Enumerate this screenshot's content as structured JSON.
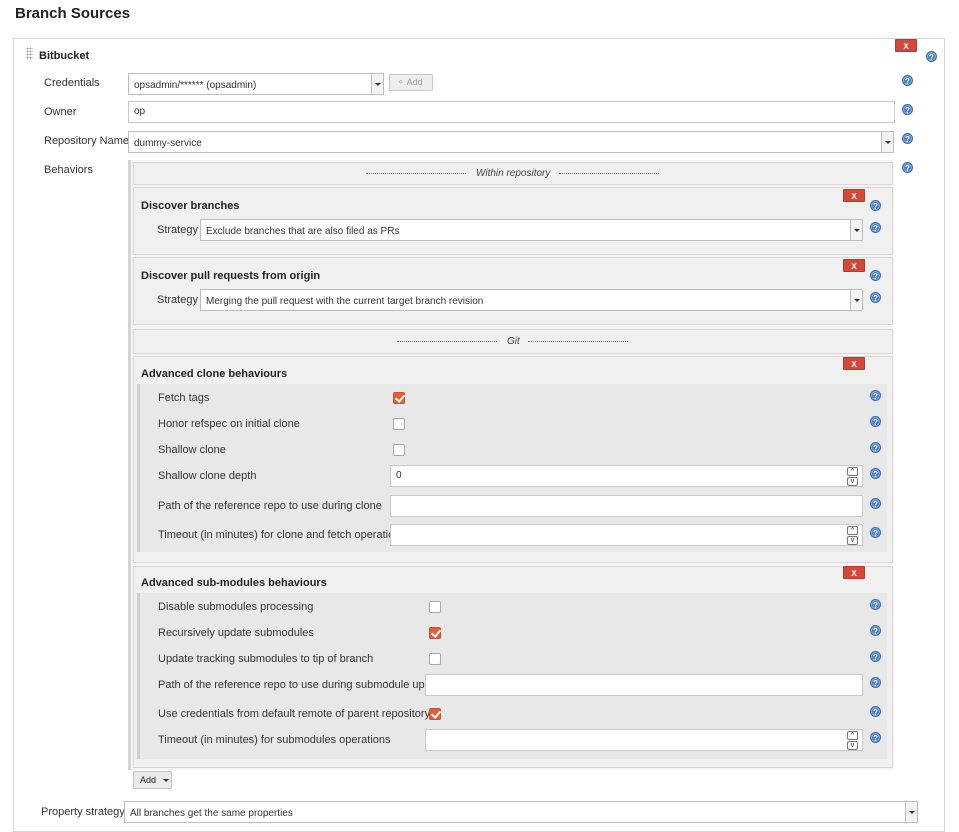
{
  "page": {
    "title": "Branch Sources"
  },
  "source": {
    "name": "Bitbucket",
    "delete_label": "X",
    "credentials": {
      "label": "Credentials",
      "value": "opsadmin/****** (opsadmin)",
      "add_label": "Add"
    },
    "owner": {
      "label": "Owner",
      "value": "op"
    },
    "repository": {
      "label": "Repository Name",
      "value": "dummy-service"
    },
    "behaviors": {
      "label": "Behaviors"
    }
  },
  "behaviors": {
    "within_repo_header": "Within repository",
    "git_header": "Git",
    "discover_branches": {
      "title": "Discover branches",
      "strategy_label": "Strategy",
      "strategy_value": "Exclude branches that are also filed as PRs"
    },
    "discover_prs": {
      "title": "Discover pull requests from origin",
      "strategy_label": "Strategy",
      "strategy_value": "Merging the pull request with the current target branch revision"
    },
    "advanced_clone": {
      "title": "Advanced clone behaviours",
      "fetch_tags": {
        "label": "Fetch tags",
        "checked": true
      },
      "honor_refspec": {
        "label": "Honor refspec on initial clone",
        "checked": false
      },
      "shallow_clone": {
        "label": "Shallow clone",
        "checked": false
      },
      "shallow_depth": {
        "label": "Shallow clone depth",
        "value": "0"
      },
      "reference_repo": {
        "label": "Path of the reference repo to use during clone",
        "value": ""
      },
      "timeout": {
        "label": "Timeout (in minutes) for clone and fetch operations",
        "value": ""
      }
    },
    "advanced_submodules": {
      "title": "Advanced sub-modules behaviours",
      "disable": {
        "label": "Disable submodules processing",
        "checked": false
      },
      "recursive": {
        "label": "Recursively update submodules",
        "checked": true
      },
      "tracking": {
        "label": "Update tracking submodules to tip of branch",
        "checked": false
      },
      "reference_repo": {
        "label": "Path of the reference repo to use during submodule update",
        "value": ""
      },
      "use_credentials": {
        "label": "Use credentials from default remote of parent repository",
        "checked": true
      },
      "timeout": {
        "label": "Timeout (in minutes) for submodules operations",
        "value": ""
      }
    },
    "add_label": "Add"
  },
  "property_strategy": {
    "label": "Property strategy",
    "value": "All branches get the same properties"
  },
  "icons": {
    "help": "help-icon",
    "delete": "delete-button",
    "key": "key-icon",
    "checkbox_accent": "#e0603b",
    "delete_color": "#d24939",
    "help_color": "#4a7fc1"
  }
}
